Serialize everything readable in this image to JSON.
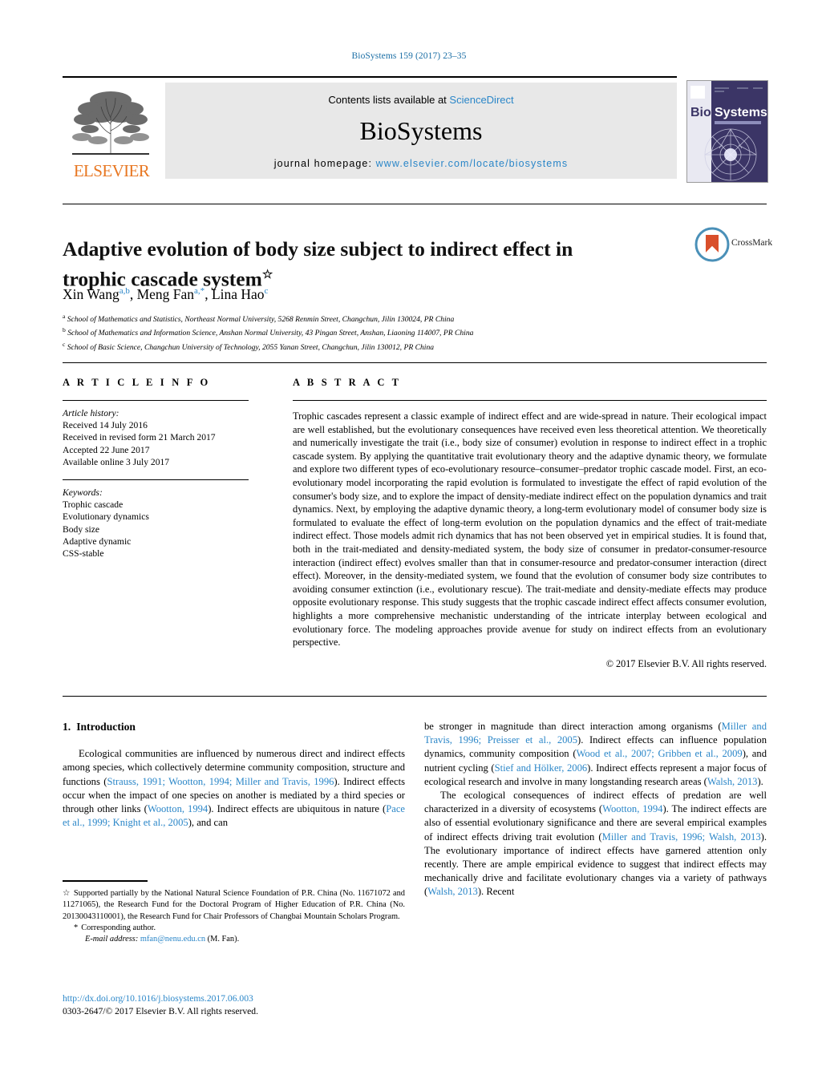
{
  "running_head": "BioSystems 159 (2017) 23–35",
  "masthead": {
    "contents_label": "Contents lists available at",
    "sciencedirect": "ScienceDirect",
    "journal_name": "BioSystems",
    "homepage_label": "journal homepage:",
    "homepage_url": "www.elsevier.com/locate/biosystems",
    "publisher_wordmark": "ELSEVIER",
    "cover_title_left": "Bio",
    "cover_title_right": "Systems",
    "accent_link_color": "#2a86c8",
    "publisher_color": "#E87722"
  },
  "article": {
    "title": "Adaptive evolution of body size subject to indirect effect in trophic cascade system",
    "title_footnote_marker": "☆",
    "crossmark_label": "CrossMark",
    "authors": [
      {
        "name": "Xin Wang",
        "marks": "a,b"
      },
      {
        "name": "Meng Fan",
        "marks": "a,*"
      },
      {
        "name": "Lina Hao",
        "marks": "c"
      }
    ],
    "affiliations": [
      {
        "mark": "a",
        "text": "School of Mathematics and Statistics, Northeast Normal University, 5268 Renmin Street, Changchun, Jilin 130024, PR China"
      },
      {
        "mark": "b",
        "text": "School of Mathematics and Information Science, Anshan Normal University, 43 Pingan Street, Anshan, Liaoning 114007, PR China"
      },
      {
        "mark": "c",
        "text": "School of Basic Science, Changchun University of Technology, 2055 Yanan Street, Changchun, Jilin 130012, PR China"
      }
    ]
  },
  "info": {
    "heading": "A R T I C L E   I N F O",
    "history_title": "Article history:",
    "history": [
      "Received 14 July 2016",
      "Received in revised form 21 March 2017",
      "Accepted 22 June 2017",
      "Available online 3 July 2017"
    ],
    "keywords_title": "Keywords:",
    "keywords": [
      "Trophic cascade",
      "Evolutionary dynamics",
      "Body size",
      "Adaptive dynamic",
      "CSS-stable"
    ]
  },
  "abstract": {
    "heading": "A B S T R A C T",
    "text": "Trophic cascades represent a classic example of indirect effect and are wide-spread in nature. Their ecological impact are well established, but the evolutionary consequences have received even less theoretical attention. We theoretically and numerically investigate the trait (i.e., body size of consumer) evolution in response to indirect effect in a trophic cascade system. By applying the quantitative trait evolutionary theory and the adaptive dynamic theory, we formulate and explore two different types of eco-evolutionary resource–consumer–predator trophic cascade model. First, an eco-evolutionary model incorporating the rapid evolution is formulated to investigate the effect of rapid evolution of the consumer's body size, and to explore the impact of density-mediate indirect effect on the population dynamics and trait dynamics. Next, by employing the adaptive dynamic theory, a long-term evolutionary model of consumer body size is formulated to evaluate the effect of long-term evolution on the population dynamics and the effect of trait-mediate indirect effect. Those models admit rich dynamics that has not been observed yet in empirical studies. It is found that, both in the trait-mediated and density-mediated system, the body size of consumer in predator-consumer-resource interaction (indirect effect) evolves smaller than that in consumer-resource and predator-consumer interaction (direct effect). Moreover, in the density-mediated system, we found that the evolution of consumer body size contributes to avoiding consumer extinction (i.e., evolutionary rescue). The trait-mediate and density-mediate effects may produce opposite evolutionary response. This study suggests that the trophic cascade indirect effect affects consumer evolution, highlights a more comprehensive mechanistic understanding of the intricate interplay between ecological and evolutionary force. The modeling approaches provide avenue for study on indirect effects from an evolutionary perspective.",
    "copyright": "© 2017 Elsevier B.V. All rights reserved."
  },
  "body": {
    "section_number": "1.",
    "section_title": "Introduction",
    "left_paragraphs": [
      [
        {
          "t": "Ecological communities are influenced by numerous direct and indirect effects among species, which collectively determine community composition, structure and functions ("
        },
        {
          "t": "Strauss, 1991; Wootton, 1994; Miller and Travis, 1996",
          "c": true
        },
        {
          "t": "). Indirect effects occur when the impact of one species on another is mediated by a third species or through other links ("
        },
        {
          "t": "Wootton, 1994",
          "c": true
        },
        {
          "t": "). Indirect effects are ubiquitous in nature ("
        },
        {
          "t": "Pace et al., 1999; Knight et al., 2005",
          "c": true
        },
        {
          "t": "), and can"
        }
      ]
    ],
    "right_paragraphs": [
      [
        {
          "t": "be stronger in magnitude than direct interaction among organisms ("
        },
        {
          "t": "Miller and Travis, 1996; Preisser et al., 2005",
          "c": true
        },
        {
          "t": "). Indirect effects can influence population dynamics, community composition ("
        },
        {
          "t": "Wood et al., 2007; Gribben et al., 2009",
          "c": true
        },
        {
          "t": "), and nutrient cycling ("
        },
        {
          "t": "Stief and Hölker, 2006",
          "c": true
        },
        {
          "t": "). Indirect effects represent a major focus of ecological research and involve in many longstanding research areas ("
        },
        {
          "t": "Walsh, 2013",
          "c": true
        },
        {
          "t": ")."
        }
      ],
      [
        {
          "t": "The ecological consequences of indirect effects of predation are well characterized in a diversity of ecosystems ("
        },
        {
          "t": "Wootton, 1994",
          "c": true
        },
        {
          "t": "). The indirect effects are also of essential evolutionary significance and there are several empirical examples of indirect effects driving trait evolution ("
        },
        {
          "t": "Miller and Travis, 1996; Walsh, 2013",
          "c": true
        },
        {
          "t": "). The evolutionary importance of indirect effects have garnered attention only recently. There are ample empirical evidence to suggest that indirect effects may mechanically drive and facilitate evolutionary changes via a variety of pathways ("
        },
        {
          "t": "Walsh, 2013",
          "c": true
        },
        {
          "t": "). Recent"
        }
      ]
    ]
  },
  "footnotes": {
    "funding_marker": "☆",
    "funding_text": "Supported partially by the National Natural Science Foundation of P.R. China (No. 11671072 and 11271065), the Research Fund for the Doctoral Program of Higher Education of P.R. China (No. 20130043110001), the Research Fund for Chair Professors of Changbai Mountain Scholars Program.",
    "corresponding_marker": "*",
    "corresponding_text": "Corresponding author.",
    "email_label": "E-mail address:",
    "email": "mfan@nenu.edu.cn",
    "email_person": "(M. Fan)."
  },
  "imprint": {
    "doi": "http://dx.doi.org/10.1016/j.biosystems.2017.06.003",
    "issn_line": "0303-2647/© 2017 Elsevier B.V. All rights reserved."
  }
}
